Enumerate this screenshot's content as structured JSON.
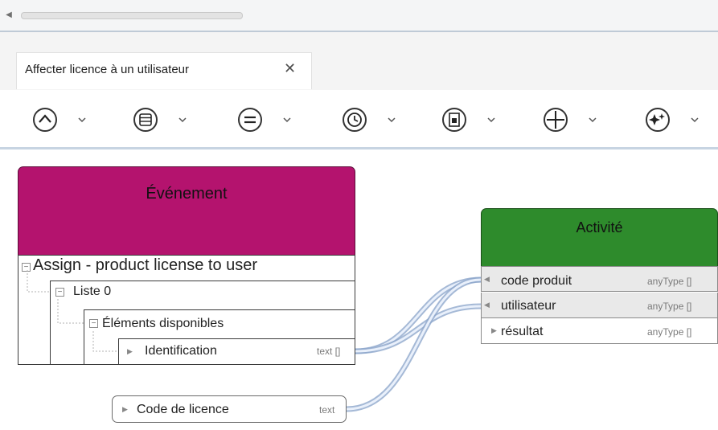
{
  "tab": {
    "title": "Affecter licence à un utilisateur",
    "close_glyph": "✕"
  },
  "toolbar": {
    "buttons": [
      {
        "icon": "chevron-up-circle-icon"
      },
      {
        "icon": "list-circle-icon"
      },
      {
        "icon": "equals-circle-icon"
      },
      {
        "icon": "clock-circle-icon"
      },
      {
        "icon": "document-circle-icon"
      },
      {
        "icon": "plus-circle-icon"
      },
      {
        "icon": "sparkle-circle-icon"
      }
    ]
  },
  "event_node": {
    "title": "Événement",
    "root_label": "Assign - product license to user",
    "list_label": "Liste 0",
    "available_label": "Éléments disponibles",
    "field_label": "Identification",
    "field_type": "text []"
  },
  "activity_node": {
    "title": "Activité",
    "inputs": [
      {
        "label": "code produit",
        "type": "anyType []"
      },
      {
        "label": "utilisateur",
        "type": "anyType []"
      }
    ],
    "output": {
      "label": "résultat",
      "type": "anyType []"
    }
  },
  "license_code": {
    "label": "Code de licence",
    "type": "text"
  },
  "colors": {
    "event": "#b4136e",
    "activity": "#2e8b2c",
    "wire": "#b9cbe6"
  }
}
